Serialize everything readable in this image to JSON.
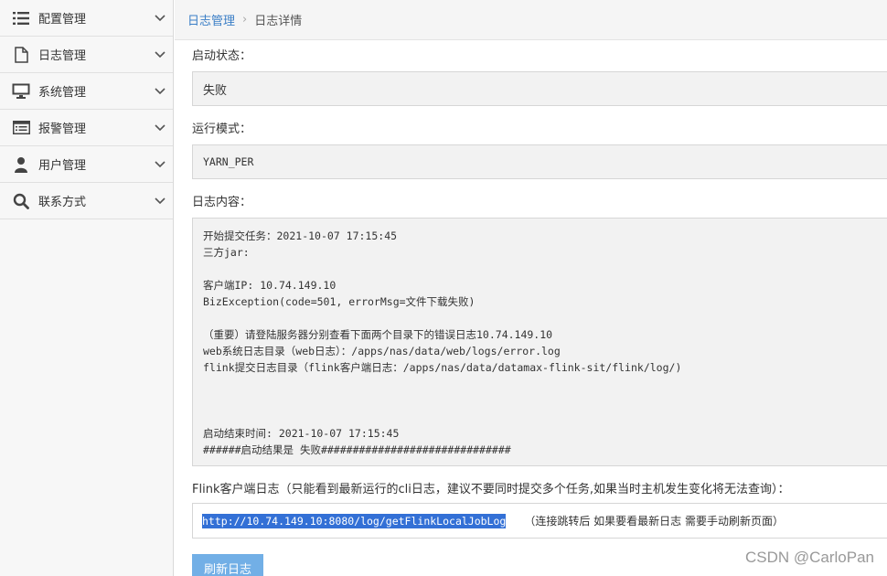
{
  "sidebar": {
    "items": [
      {
        "label": "配置管理",
        "icon": "list-icon"
      },
      {
        "label": "日志管理",
        "icon": "file-icon"
      },
      {
        "label": "系统管理",
        "icon": "monitor-icon"
      },
      {
        "label": "报警管理",
        "icon": "table-icon"
      },
      {
        "label": "用户管理",
        "icon": "user-icon"
      },
      {
        "label": "联系方式",
        "icon": "search-icon"
      }
    ]
  },
  "breadcrumb": {
    "parent": "日志管理",
    "separator": "›",
    "current": "日志详情"
  },
  "form": {
    "status_label": "启动状态：",
    "status_value": "失败",
    "mode_label": "运行模式：",
    "mode_value": "YARN_PER",
    "log_label": "日志内容：",
    "log_lines": [
      "开始提交任务：2021-10-07 17:15:45",
      "三方jar:",
      "",
      "客户端IP: 10.74.149.10",
      "BizException(code=501, errorMsg=文件下载失败)",
      "",
      "（重要）请登陆服务器分别查看下面两个目录下的错误日志10.74.149.10",
      "web系统日志目录（web日志）：/apps/nas/data/web/logs/error.log",
      "flink提交日志目录（flink客户端日志：/apps/nas/data/datamax-flink-sit/flink/log/)",
      "",
      "",
      "",
      "启动结束时间: 2021-10-07 17:15:45",
      "######启动结果是 失败##############################"
    ],
    "flink_label": "Flink客户端日志（只能看到最新运行的cli日志，建议不要同时提交多个任务,如果当时主机发生变化将无法查询）：",
    "flink_link": "http://10.74.149.10:8080/log/getFlinkLocalJobLog",
    "flink_note": "（连接跳转后 如果要看最新日志 需要手动刷新页面）",
    "refresh_button": "刷新日志"
  },
  "watermark": "CSDN @CarloPan",
  "colors": {
    "link": "#3a7ec6",
    "selection": "#3370d6",
    "button": "#72afe6"
  }
}
